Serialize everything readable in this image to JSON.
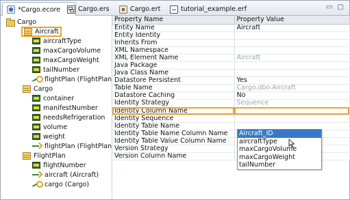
{
  "tabs": [
    {
      "label": "*Cargo.ecore",
      "icon": "ecore-file-icon",
      "active": true,
      "close": "✕"
    },
    {
      "label": "Cargo.ers",
      "icon": "ers-file-icon",
      "active": false
    },
    {
      "label": "Cargo.ert",
      "icon": "ert-file-icon",
      "active": false
    },
    {
      "label": "tutorial_example.erf",
      "icon": "erf-file-icon",
      "active": false
    }
  ],
  "window_controls": "▭ ▢",
  "tree": {
    "root": "Cargo",
    "classes": [
      {
        "label": "Aircraft",
        "selected": true,
        "children": [
          {
            "label": "aircraftType",
            "kind": "attribute"
          },
          {
            "label": "maxCargoVolume",
            "kind": "attribute"
          },
          {
            "label": "maxCargoWeight",
            "kind": "attribute"
          },
          {
            "label": "tailNumber",
            "kind": "attribute"
          },
          {
            "label": "flightPlan (FlightPlan)",
            "kind": "reference"
          }
        ]
      },
      {
        "label": "Cargo",
        "selected": false,
        "children": [
          {
            "label": "container",
            "kind": "attribute"
          },
          {
            "label": "manifestNumber",
            "kind": "attribute"
          },
          {
            "label": "needsRefrigeration",
            "kind": "attribute"
          },
          {
            "label": "volume",
            "kind": "attribute"
          },
          {
            "label": "weight",
            "kind": "attribute"
          },
          {
            "label": "flightPlan (FlightPlan)",
            "kind": "reference-arrow"
          }
        ]
      },
      {
        "label": "FlightPlan",
        "selected": false,
        "children": [
          {
            "label": "flightNumber",
            "kind": "attribute"
          },
          {
            "label": "aircraft (Aircraft)",
            "kind": "reference-arrow"
          },
          {
            "label": "cargo (Cargo)",
            "kind": "reference"
          }
        ]
      }
    ]
  },
  "properties": {
    "header_name": "Property Name",
    "header_value": "Property Value",
    "rows": [
      {
        "name": "Entity Name",
        "value": "Aircraft",
        "grey": false
      },
      {
        "name": "Entity Identity",
        "value": "",
        "grey": false
      },
      {
        "name": "Inherits From",
        "value": "",
        "grey": false
      },
      {
        "name": "XML Namespace",
        "value": "",
        "grey": false
      },
      {
        "name": "XML Element Name",
        "value": "Aircraft",
        "grey": true
      },
      {
        "name": "Java Package",
        "value": "",
        "grey": false
      },
      {
        "name": "Java Class Name",
        "value": "",
        "grey": false
      },
      {
        "name": "Datastore Persistent",
        "value": "Yes",
        "grey": false
      },
      {
        "name": "Table Name",
        "value": "Cargo.dbo.Aircraft",
        "grey": true
      },
      {
        "name": "Datastore Caching",
        "value": "No",
        "grey": false
      },
      {
        "name": "Identity Strategy",
        "value": "Sequence",
        "grey": true
      },
      {
        "name": "Identity Column Name",
        "value": "",
        "grey": false,
        "highlight": true
      },
      {
        "name": "Identity Sequence",
        "value": "",
        "grey": false
      },
      {
        "name": "Identity Table Name",
        "value": "",
        "grey": false
      },
      {
        "name": "Identity Table Name Column Name",
        "value": "",
        "grey": false
      },
      {
        "name": "Identity Table Value Column Name",
        "value": "",
        "grey": false
      },
      {
        "name": "Version Strategy",
        "value": "",
        "grey": false
      },
      {
        "name": "Version Column Name",
        "value": "",
        "grey": false
      }
    ]
  },
  "dropdown": {
    "options": [
      "Aircraft_ID",
      "aircraftType",
      "maxCargoVolume",
      "maxCargoWeight",
      "tailNumber"
    ],
    "selected_index": 0
  }
}
